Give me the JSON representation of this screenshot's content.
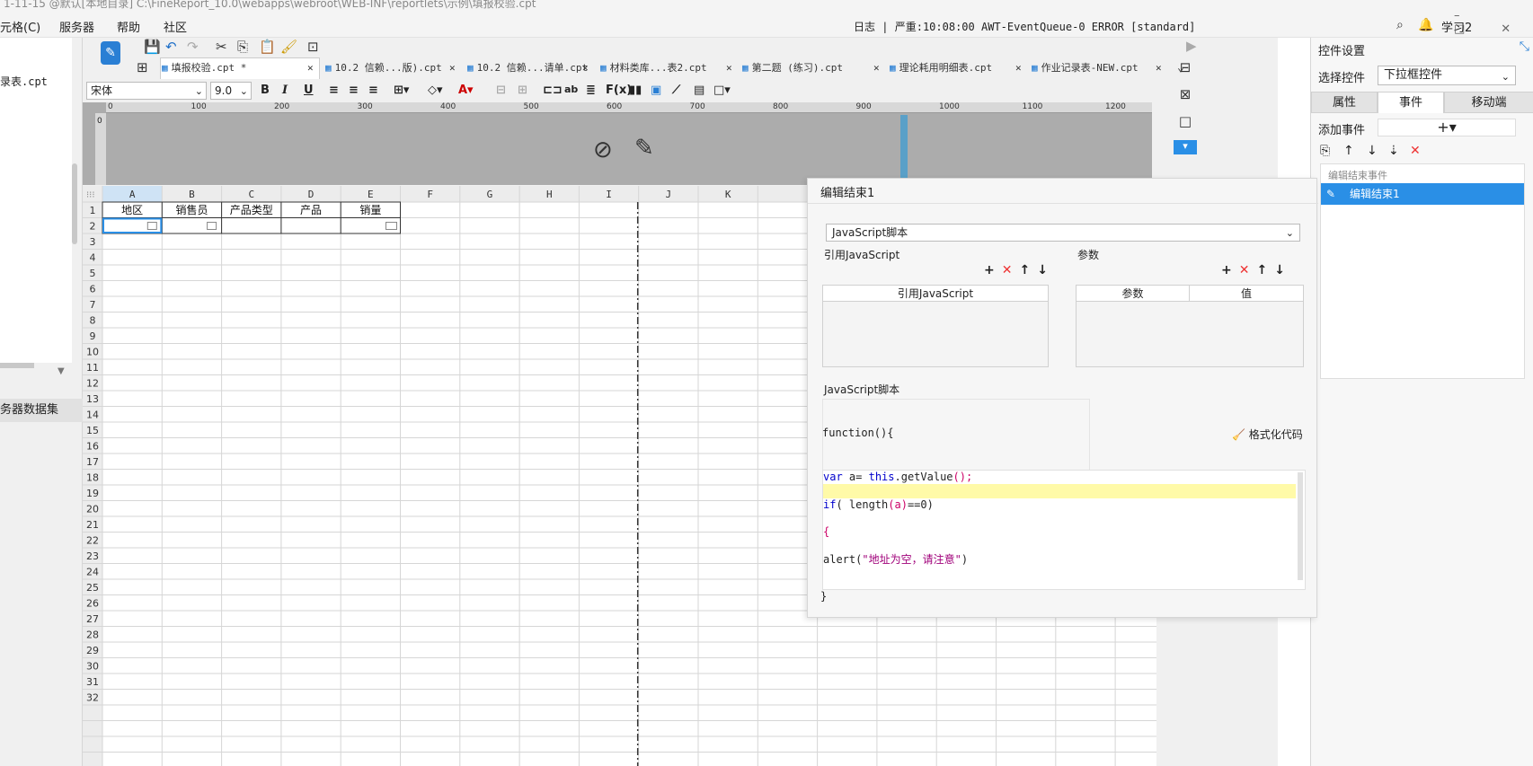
{
  "titlebar": {
    "text": "1-11-15 @默认[本地目录]     C:\\FineReport_10.0\\webapps\\webroot\\WEB-INF\\reportlets\\示例\\填报校验.cpt"
  },
  "menu": {
    "items": [
      "元格(C)",
      "服务器",
      "帮助",
      "社区"
    ]
  },
  "log": {
    "label": "日志",
    "sep": "|",
    "level": "严重:10:08:00 AWT-EventQueue-0 ERROR [standard]"
  },
  "user": {
    "name": "学习2"
  },
  "left": {
    "file": "录表.cpt",
    "dataset": "务器数据集"
  },
  "tabs": [
    {
      "label": "填报校验.cpt *"
    },
    {
      "label": "10.2 信赖...版).cpt"
    },
    {
      "label": "10.2 信赖...请单.cpt"
    },
    {
      "label": "材料类库...表2.cpt"
    },
    {
      "label": "第二题 (练习).cpt"
    },
    {
      "label": "理论耗用明细表.cpt"
    },
    {
      "label": "作业记录表-NEW.cpt"
    }
  ],
  "format": {
    "font": "宋体",
    "size": "9.0"
  },
  "ruler": {
    "ticks": [
      "0",
      "100",
      "200",
      "300",
      "400",
      "500",
      "600",
      "700",
      "800",
      "900",
      "1000",
      "1100",
      "1200"
    ],
    "vtick": "0"
  },
  "grid": {
    "cols": [
      "A",
      "B",
      "C",
      "D",
      "E",
      "F",
      "G",
      "H",
      "I",
      "J",
      "K"
    ],
    "rows": [
      "1",
      "2",
      "3",
      "4",
      "5",
      "6",
      "7",
      "8",
      "9",
      "10",
      "11",
      "12",
      "13",
      "14",
      "15",
      "16",
      "17",
      "18",
      "19",
      "20",
      "21",
      "22",
      "23",
      "24",
      "25",
      "26",
      "27",
      "28",
      "29",
      "30",
      "31",
      "32"
    ],
    "headers": [
      "地区",
      "销售员",
      "产品类型",
      "产品",
      "销量"
    ]
  },
  "right": {
    "title": "控件设置",
    "select_label": "选择控件",
    "select_value": "下拉框控件",
    "tabs": [
      "属性",
      "事件",
      "移动端"
    ],
    "add_event_label": "添加事件",
    "add_symbol": "+",
    "event_category": "编辑结束事件",
    "event_item": "编辑结束1"
  },
  "dialog": {
    "title": "编辑结束1",
    "type": "JavaScript脚本",
    "ref_label": "引用JavaScript",
    "param_label": "参数",
    "ref_col": "引用JavaScript",
    "param_col": "参数",
    "value_col": "值",
    "script_label": "JavaScript脚本",
    "func_sig": "function(){",
    "format_btn": "格式化代码",
    "close_brace": "}",
    "code": {
      "l1a": "var",
      "l1b": " a= ",
      "l1c": "this",
      "l1d": ".getValue",
      "l1e": "();",
      "l2a": "if",
      "l2b": "( length",
      "l2c": "(a)",
      "l2d": "==0)",
      "l3": "{",
      "l4a": "alert(",
      "l4b": "\"地址为空，请注意\"",
      "l4c": ")"
    }
  }
}
